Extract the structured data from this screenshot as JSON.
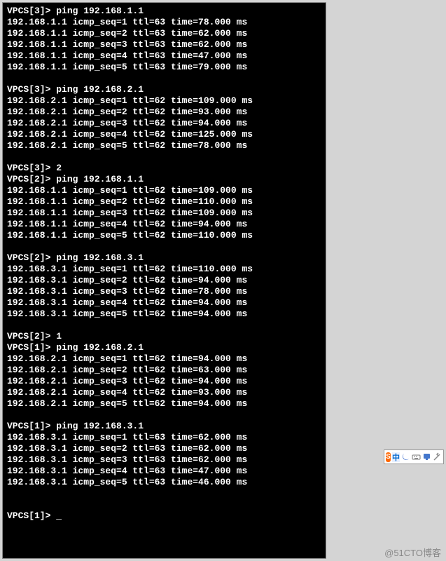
{
  "blocks": [
    {
      "prompt": "VPCS[3]> ping 192.168.1.1",
      "responses": [
        "192.168.1.1 icmp_seq=1 ttl=63 time=78.000 ms",
        "192.168.1.1 icmp_seq=2 ttl=63 time=62.000 ms",
        "192.168.1.1 icmp_seq=3 ttl=63 time=62.000 ms",
        "192.168.1.1 icmp_seq=4 ttl=63 time=47.000 ms",
        "192.168.1.1 icmp_seq=5 ttl=63 time=79.000 ms"
      ]
    },
    {
      "prompt": "VPCS[3]> ping 192.168.2.1",
      "responses": [
        "192.168.2.1 icmp_seq=1 ttl=62 time=109.000 ms",
        "192.168.2.1 icmp_seq=2 ttl=62 time=93.000 ms",
        "192.168.2.1 icmp_seq=3 ttl=62 time=94.000 ms",
        "192.168.2.1 icmp_seq=4 ttl=62 time=125.000 ms",
        "192.168.2.1 icmp_seq=5 ttl=62 time=78.000 ms"
      ]
    },
    {
      "prompt": "VPCS[3]> 2",
      "responses": []
    },
    {
      "prompt": "VPCS[2]> ping 192.168.1.1",
      "responses": [
        "192.168.1.1 icmp_seq=1 ttl=62 time=109.000 ms",
        "192.168.1.1 icmp_seq=2 ttl=62 time=110.000 ms",
        "192.168.1.1 icmp_seq=3 ttl=62 time=109.000 ms",
        "192.168.1.1 icmp_seq=4 ttl=62 time=94.000 ms",
        "192.168.1.1 icmp_seq=5 ttl=62 time=110.000 ms"
      ]
    },
    {
      "prompt": "VPCS[2]> ping 192.168.3.1",
      "responses": [
        "192.168.3.1 icmp_seq=1 ttl=62 time=110.000 ms",
        "192.168.3.1 icmp_seq=2 ttl=62 time=94.000 ms",
        "192.168.3.1 icmp_seq=3 ttl=62 time=78.000 ms",
        "192.168.3.1 icmp_seq=4 ttl=62 time=94.000 ms",
        "192.168.3.1 icmp_seq=5 ttl=62 time=94.000 ms"
      ]
    },
    {
      "prompt": "VPCS[2]> 1",
      "responses": []
    },
    {
      "prompt": "VPCS[1]> ping 192.168.2.1",
      "responses": [
        "192.168.2.1 icmp_seq=1 ttl=62 time=94.000 ms",
        "192.168.2.1 icmp_seq=2 ttl=62 time=63.000 ms",
        "192.168.2.1 icmp_seq=3 ttl=62 time=94.000 ms",
        "192.168.2.1 icmp_seq=4 ttl=62 time=93.000 ms",
        "192.168.2.1 icmp_seq=5 ttl=62 time=94.000 ms"
      ]
    },
    {
      "prompt": "VPCS[1]> ping 192.168.3.1",
      "responses": [
        "192.168.3.1 icmp_seq=1 ttl=63 time=62.000 ms",
        "192.168.3.1 icmp_seq=2 ttl=63 time=62.000 ms",
        "192.168.3.1 icmp_seq=3 ttl=63 time=62.000 ms",
        "192.168.3.1 icmp_seq=4 ttl=63 time=47.000 ms",
        "192.168.3.1 icmp_seq=5 ttl=63 time=46.000 ms"
      ]
    }
  ],
  "final_prompt": "VPCS[1]> _",
  "toolbar": {
    "s": "S",
    "cn": "中"
  },
  "watermark": "@51CTO博客"
}
